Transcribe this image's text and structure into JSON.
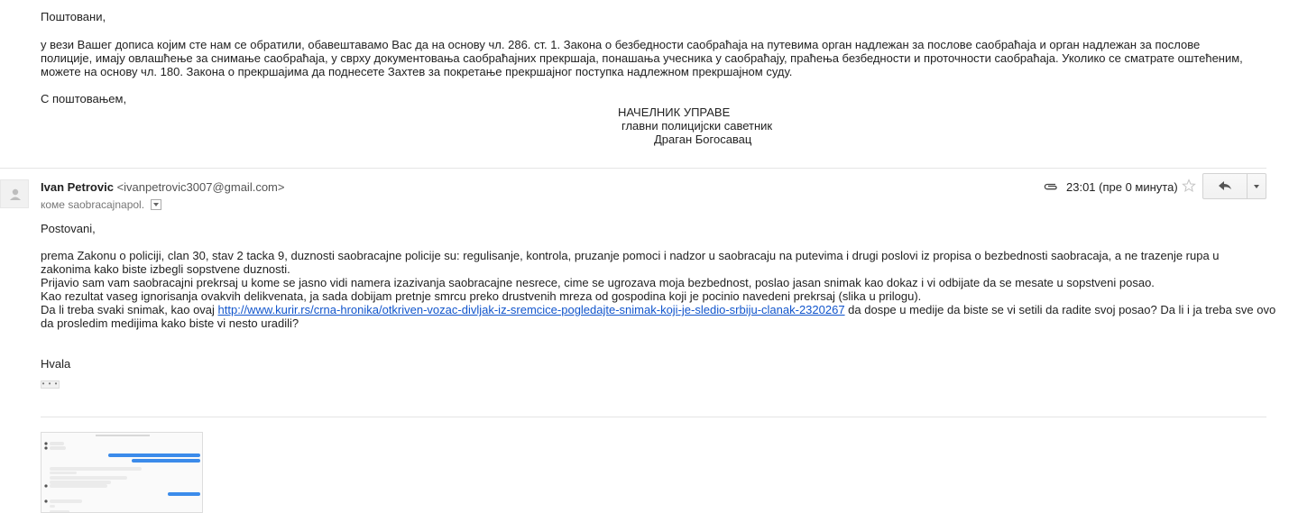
{
  "prev_message": {
    "greeting": "Поштовани,",
    "body_lines": [
      "у вези Вашег дописа којим сте нам се обратили, обавештавамо Вас да на основу чл. 286. ст. 1. Закона о безбедности саобраћаја на путевима орган надлежан за послове саобраћаја и орган надлежан за послове",
      "полиције, имају овлашћење за снимање саобраћаја, у сврху документовања саобраћајних прекршаја, понашања учесника у саобраћају, праћења безбедности и проточности саобраћаја. Уколико се сматрате оштећеним,",
      "можете на основу чл. 180. Закона о прекршајима да поднесете Захтев за покретање прекршајног поступка надлежном прекршајном суду."
    ],
    "closing": "С поштовањем,",
    "signature": {
      "title": "НАЧЕЛНИК УПРАВЕ",
      "role": "главни полицијски саветник",
      "name": "Драган Богосавац"
    }
  },
  "message": {
    "sender_name": "Ivan Petrovic",
    "sender_email": "<ivanpetrovic3007@gmail.com>",
    "to_line": "коме saobracajnapol.",
    "timestamp": "23:01 (пре 0 минута)",
    "greeting": "Postovani,",
    "line1": "prema Zakonu o policiji, clan 30, stav 2 tacka 9, duznosti saobracajne policije su:  regulisanje, kontrola, pruzanje pomoci i nadzor u saobracaju na putevima i drugi poslovi iz propisa o bezbednosti saobracaja, a ne trazenje rupa u",
    "line2": "zakonima kako biste izbegli sopstvene duznosti.",
    "line3": "Prijavio sam vam saobracajni prekrsaj u kome se jasno vidi namera izazivanja saobracajne nesrece, cime se ugrozava moja bezbednost, poslao jasan snimak kao dokaz i vi odbijate da se mesate u sopstveni posao.",
    "line4": "Kao rezultat vaseg ignorisanja ovakvih delikvenata, ja sada dobijam pretnje smrcu preko drustvenih mreza od gospodina koji je pocinio navedeni prekrsaj (slika u prilogu).",
    "line5_pre": "Da li treba svaki snimak, kao ovaj ",
    "line5_link": "http://www.kurir.rs/crna-hronika/otkriven-vozac-divljak-iz-sremcice-pogledajte-snimak-koji-je-sledio-srbiju-clanak-2320267",
    "line5_post": " da dospe u medije da biste se vi setili da radite svoj posao? Da li i ja treba sve ovo",
    "line6": "da prosledim medijima kako biste vi nesto uradili?",
    "thanks": "Hvala",
    "ellipsis": "• • •"
  },
  "icons": {
    "attachment": "paperclip-icon",
    "star": "star-icon",
    "reply": "reply-icon",
    "more": "chevron-down-icon",
    "avatar": "avatar-icon"
  },
  "colors": {
    "link": "#1155cc",
    "text": "#222222",
    "chat_bubble": "#3b8bea"
  }
}
